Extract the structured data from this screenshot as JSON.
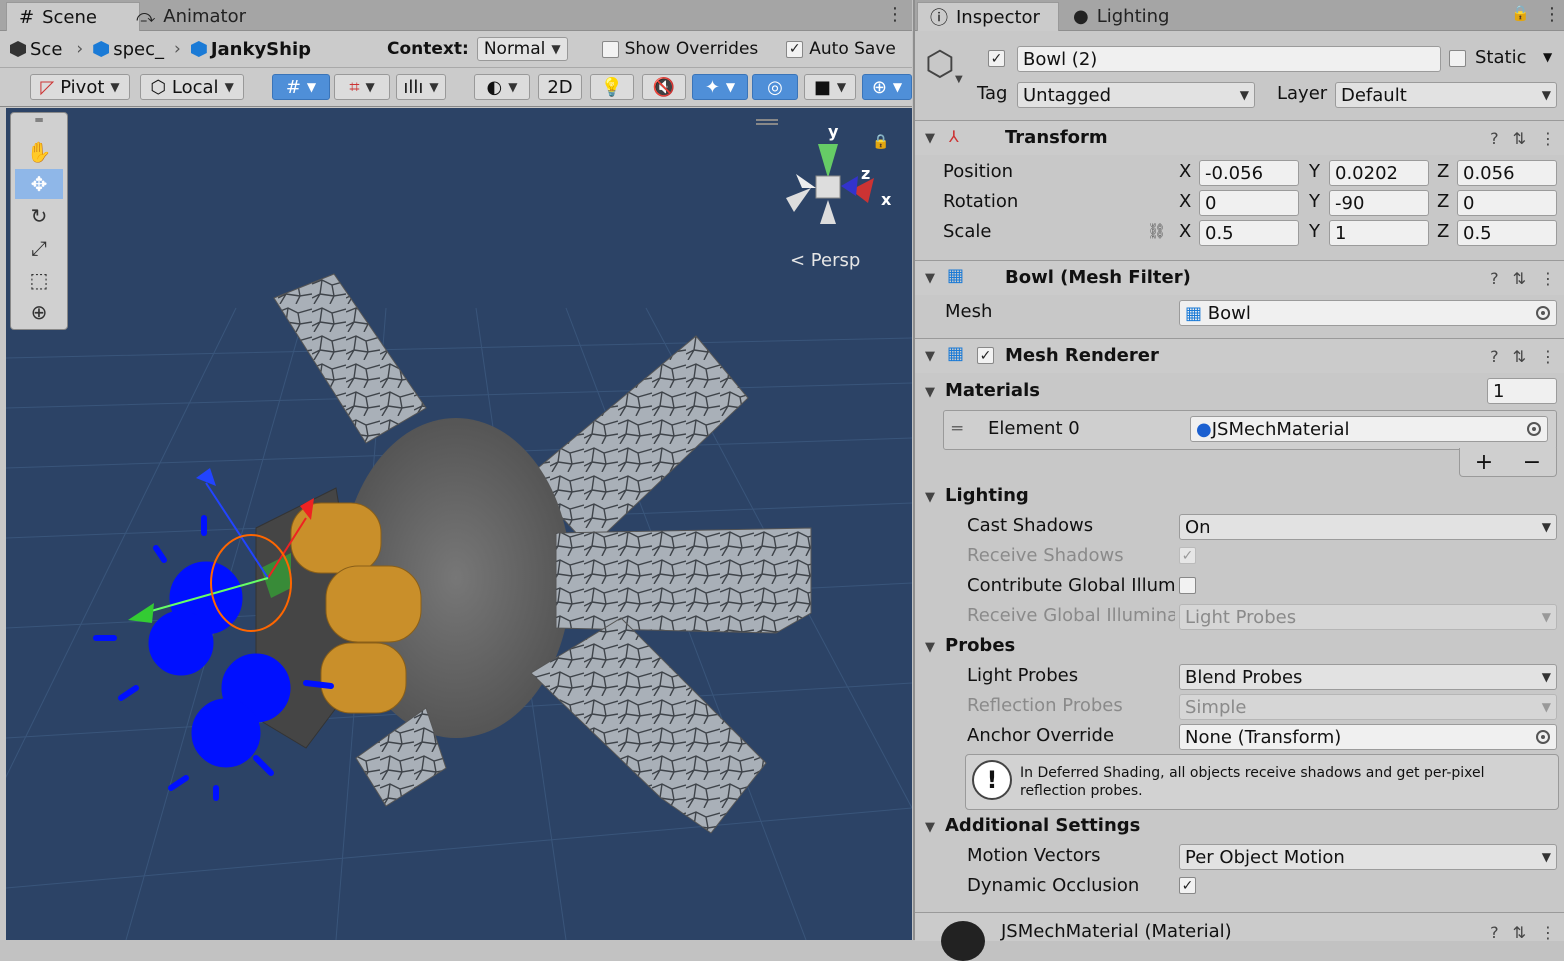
{
  "scene": {
    "tabs": [
      {
        "label": "Scene"
      },
      {
        "label": "Animator"
      }
    ],
    "breadcrumb": [
      {
        "label": "Sce"
      },
      {
        "label": "spec_"
      },
      {
        "label": "JankyShip"
      }
    ],
    "context_label": "Context:",
    "context_value": "Normal",
    "show_overrides": "Show Overrides",
    "auto_save": "Auto Save",
    "toolbar": {
      "pivot": "Pivot",
      "local": "Local",
      "mode2d": "2D"
    },
    "gizmo": {
      "y": "y",
      "z": "z",
      "x": "x",
      "persp": "< Persp"
    }
  },
  "inspector": {
    "tabs": [
      {
        "label": "Inspector"
      },
      {
        "label": "Lighting"
      }
    ],
    "object_name": "Bowl (2)",
    "static_label": "Static",
    "tag_label": "Tag",
    "tag_value": "Untagged",
    "layer_label": "Layer",
    "layer_value": "Default",
    "transform": {
      "title": "Transform",
      "position": {
        "label": "Position",
        "x": "-0.056",
        "y": "0.0202",
        "z": "0.056"
      },
      "rotation": {
        "label": "Rotation",
        "x": "0",
        "y": "-90",
        "z": "0"
      },
      "scale": {
        "label": "Scale",
        "x": "0.5",
        "y": "1",
        "z": "0.5"
      },
      "axis": {
        "x": "X",
        "y": "Y",
        "z": "Z"
      }
    },
    "mesh_filter": {
      "title": "Bowl (Mesh Filter)",
      "mesh_label": "Mesh",
      "mesh_value": "Bowl"
    },
    "mesh_renderer": {
      "title": "Mesh Renderer",
      "materials_label": "Materials",
      "materials_count": "1",
      "element0_label": "Element 0",
      "element0_value": "JSMechMaterial",
      "add": "+",
      "remove": "−",
      "lighting_label": "Lighting",
      "cast_shadows_label": "Cast Shadows",
      "cast_shadows_value": "On",
      "receive_shadows_label": "Receive Shadows",
      "contribute_gi_label": "Contribute Global Illumi",
      "receive_gi_label": "Receive Global Illumina",
      "receive_gi_value": "Light Probes",
      "probes_label": "Probes",
      "light_probes_label": "Light Probes",
      "light_probes_value": "Blend Probes",
      "reflection_probes_label": "Reflection Probes",
      "reflection_probes_value": "Simple",
      "anchor_label": "Anchor Override",
      "anchor_value": "None (Transform)",
      "info_text": "In Deferred Shading, all objects receive shadows and get per-pixel reflection probes.",
      "additional_label": "Additional Settings",
      "motion_vectors_label": "Motion Vectors",
      "motion_vectors_value": "Per Object Motion",
      "dynamic_occlusion_label": "Dynamic Occlusion"
    },
    "material_title": "JSMechMaterial (Material)"
  },
  "colors": {
    "selection_blue": "#4f8fd8",
    "viewport_bg": "#2c4366",
    "panel": "#c8c8c8"
  }
}
